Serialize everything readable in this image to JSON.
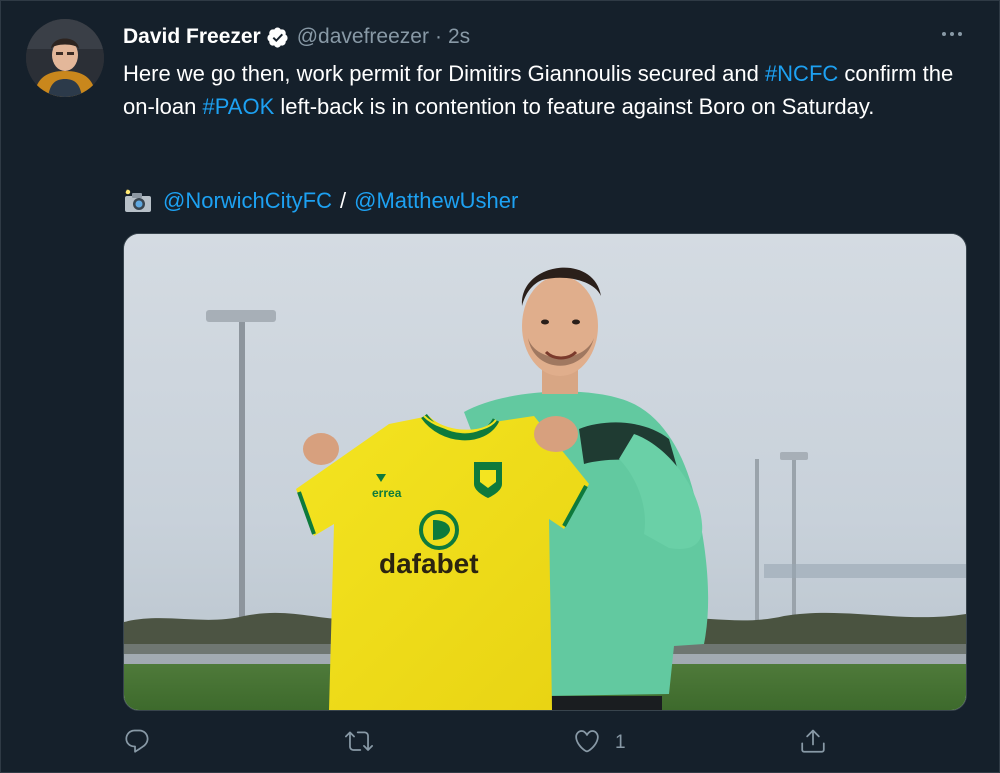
{
  "tweet": {
    "display_name": "David Freezer",
    "handle": "@davefreezer",
    "separator": "·",
    "time": "2s",
    "text": {
      "part1": "Here we go then, work permit for Dimitirs Giannoulis secured and ",
      "hashtag1": "#NCFC",
      "part2": " confirm the on-loan ",
      "hashtag2": "#PAOK",
      "part3": " left-back is in contention to feature against Boro on Saturday."
    },
    "credit": {
      "mention1": "@NorwichCityFC",
      "separator": "/",
      "mention2": "@MatthewUsher"
    },
    "media": {
      "shirt_brand": "errea",
      "shirt_sponsor": "dafabet"
    },
    "actions": {
      "reply_icon": "reply-icon",
      "retweet_icon": "retweet-icon",
      "like_icon": "like-icon",
      "like_count": "1",
      "share_icon": "share-icon"
    }
  },
  "colors": {
    "background": "#15202b",
    "link": "#1da1f2",
    "muted": "#8899a6",
    "shirt_yellow": "#f2e21b",
    "shirt_green": "#0e7a3c",
    "top_mint": "#5fc69b"
  }
}
